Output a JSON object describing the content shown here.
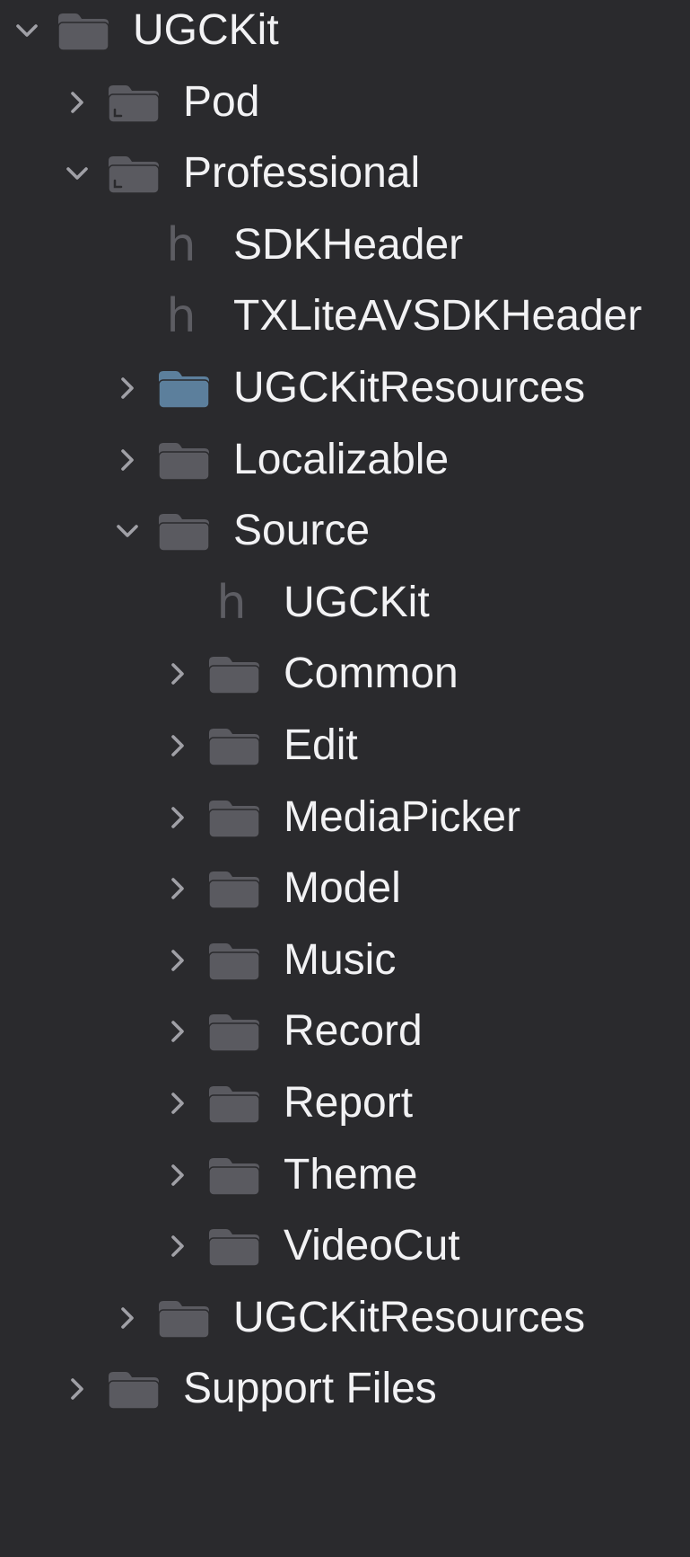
{
  "navigator": {
    "rows": [
      {
        "label": "UGCKit",
        "kind": "folder",
        "depth": 0,
        "state": "expanded",
        "icon": "folder-icon",
        "icon_color": "#5a5a60"
      },
      {
        "label": "Pod",
        "kind": "group",
        "depth": 1,
        "state": "collapsed",
        "icon": "group-folder-icon",
        "icon_color": "#5a5a60"
      },
      {
        "label": "Professional",
        "kind": "group",
        "depth": 1,
        "state": "expanded",
        "icon": "group-folder-icon",
        "icon_color": "#5a5a60"
      },
      {
        "label": "SDKHeader",
        "kind": "header",
        "depth": 2,
        "state": "leaf",
        "icon": "header-file-icon",
        "glyph": "h"
      },
      {
        "label": "TXLiteAVSDKHeader",
        "kind": "header",
        "depth": 2,
        "state": "leaf",
        "icon": "header-file-icon",
        "glyph": "h"
      },
      {
        "label": "UGCKitResources",
        "kind": "folder",
        "depth": 2,
        "state": "collapsed",
        "icon": "blue-folder-icon",
        "icon_color": "#5c7f9c"
      },
      {
        "label": "Localizable",
        "kind": "folder",
        "depth": 2,
        "state": "collapsed",
        "icon": "folder-icon",
        "icon_color": "#5a5a60"
      },
      {
        "label": "Source",
        "kind": "folder",
        "depth": 2,
        "state": "expanded",
        "icon": "folder-icon",
        "icon_color": "#5a5a60"
      },
      {
        "label": "UGCKit",
        "kind": "header",
        "depth": 3,
        "state": "leaf",
        "icon": "header-file-icon",
        "glyph": "h"
      },
      {
        "label": "Common",
        "kind": "folder",
        "depth": 3,
        "state": "collapsed",
        "icon": "folder-icon",
        "icon_color": "#5a5a60"
      },
      {
        "label": "Edit",
        "kind": "folder",
        "depth": 3,
        "state": "collapsed",
        "icon": "folder-icon",
        "icon_color": "#5a5a60"
      },
      {
        "label": "MediaPicker",
        "kind": "folder",
        "depth": 3,
        "state": "collapsed",
        "icon": "folder-icon",
        "icon_color": "#5a5a60"
      },
      {
        "label": "Model",
        "kind": "folder",
        "depth": 3,
        "state": "collapsed",
        "icon": "folder-icon",
        "icon_color": "#5a5a60"
      },
      {
        "label": "Music",
        "kind": "folder",
        "depth": 3,
        "state": "collapsed",
        "icon": "folder-icon",
        "icon_color": "#5a5a60"
      },
      {
        "label": "Record",
        "kind": "folder",
        "depth": 3,
        "state": "collapsed",
        "icon": "folder-icon",
        "icon_color": "#5a5a60"
      },
      {
        "label": "Report",
        "kind": "folder",
        "depth": 3,
        "state": "collapsed",
        "icon": "folder-icon",
        "icon_color": "#5a5a60"
      },
      {
        "label": "Theme",
        "kind": "folder",
        "depth": 3,
        "state": "collapsed",
        "icon": "folder-icon",
        "icon_color": "#5a5a60"
      },
      {
        "label": "VideoCut",
        "kind": "folder",
        "depth": 3,
        "state": "collapsed",
        "icon": "folder-icon",
        "icon_color": "#5a5a60"
      },
      {
        "label": "UGCKitResources",
        "kind": "folder",
        "depth": 2,
        "state": "collapsed",
        "icon": "folder-icon",
        "icon_color": "#5a5a60"
      },
      {
        "label": "Support Files",
        "kind": "folder",
        "depth": 1,
        "state": "collapsed",
        "icon": "folder-icon",
        "icon_color": "#5a5a60"
      }
    ]
  },
  "colors": {
    "background": "#2a2a2d",
    "text": "#f2f2f4",
    "disclosure": "#a0a0a6",
    "header_glyph": "#5d5d63"
  }
}
